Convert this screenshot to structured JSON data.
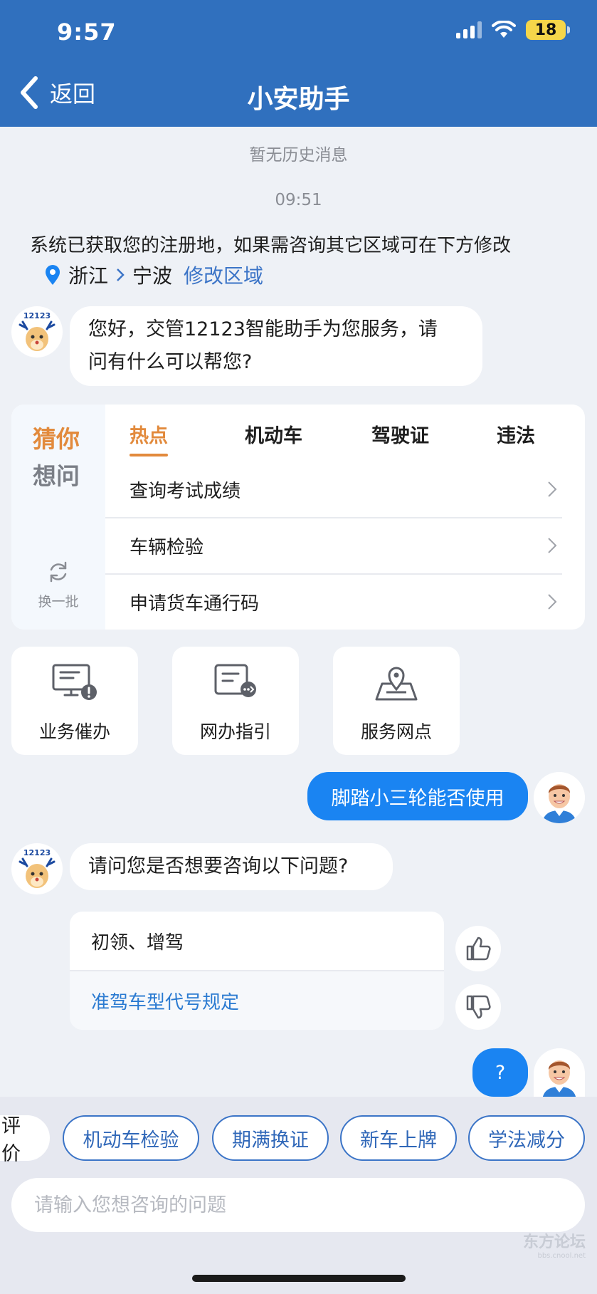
{
  "status_bar": {
    "time": "9:57",
    "battery": "18"
  },
  "nav": {
    "back_label": "返回",
    "title": "小安助手"
  },
  "chat": {
    "no_history": "暂无历史消息",
    "timestamp": "09:51",
    "notice": "系统已获取您的注册地，如果需咨询其它区域可在下方修改",
    "region": {
      "province": "浙江",
      "city": "宁波",
      "modify_label": "修改区域"
    },
    "bot_avatar_text": "12123",
    "greeting_line1": "您好，交管12123智能助手为您服务，请",
    "greeting_line2": "问有什么可以帮您?",
    "user_msg1": "脚踏小三轮能否使用",
    "bot_msg2": "请问您是否想要咨询以下问题?",
    "suggestions": [
      "初领、增驾",
      "准驾车型代号规定"
    ],
    "user_msg2": "?"
  },
  "guess": {
    "title_line1": "猜你",
    "title_line2": "想问",
    "refresh_label": "换一批",
    "tabs": [
      "热点",
      "机动车",
      "驾驶证",
      "违法"
    ],
    "active_tab": "热点",
    "questions": [
      "查询考试成绩",
      "车辆检验",
      "申请货车通行码"
    ]
  },
  "services": [
    {
      "label": "业务催办",
      "icon": "monitor-alert-icon"
    },
    {
      "label": "网办指引",
      "icon": "document-arrow-icon"
    },
    {
      "label": "服务网点",
      "icon": "map-pin-icon"
    }
  ],
  "chips": [
    "评价",
    "机动车检验",
    "期满换证",
    "新车上牌",
    "学法减分"
  ],
  "input": {
    "placeholder": "请输入您想咨询的问题"
  },
  "watermark": {
    "text": "东方论坛",
    "sub": "bbs.cnool.net"
  },
  "colors": {
    "header": "#3070be",
    "user_bubble": "#1a84f2",
    "accent_orange": "#e28a3c",
    "link_blue": "#3b74c7"
  }
}
